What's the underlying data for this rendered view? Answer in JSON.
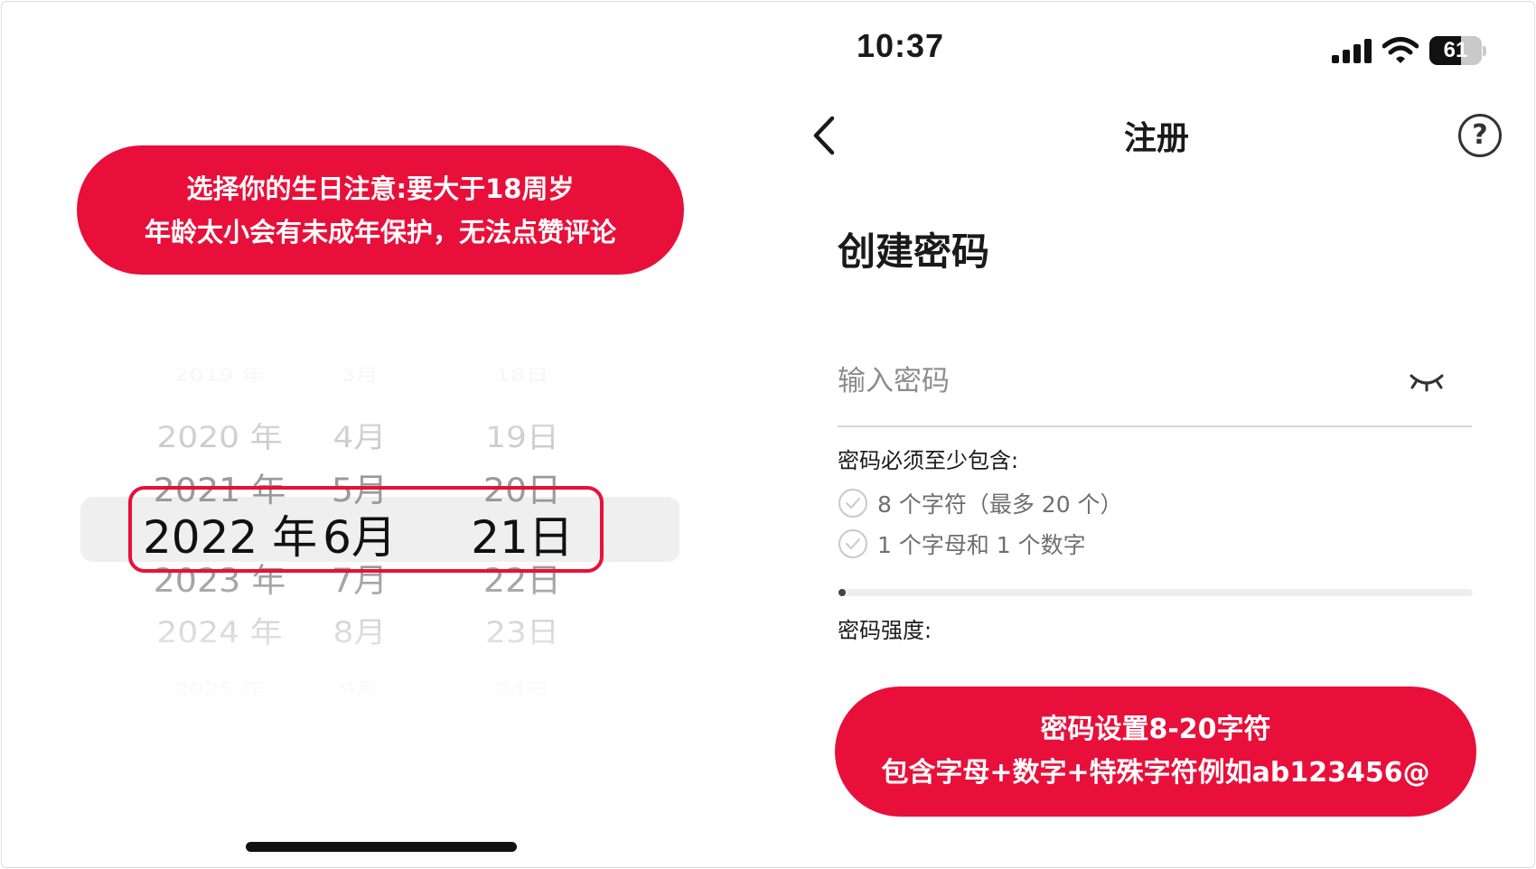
{
  "left": {
    "banner": {
      "line1": "选择你的生日注意:要大于18周岁",
      "line2": "年龄太小会有未成年保护，无法点赞评论"
    },
    "picker": {
      "rows": [
        {
          "year": "2019 年",
          "month": "3月",
          "day": "18日"
        },
        {
          "year": "2020 年",
          "month": "4月",
          "day": "19日"
        },
        {
          "year": "2021 年",
          "month": "5月",
          "day": "20日"
        },
        {
          "year": "2022 年",
          "month": "6月",
          "day": "21日"
        },
        {
          "year": "2023 年",
          "month": "7月",
          "day": "22日"
        },
        {
          "year": "2024 年",
          "month": "8月",
          "day": "23日"
        },
        {
          "year": "2025 年",
          "month": "9月",
          "day": "24日"
        }
      ],
      "selected_index": 3
    }
  },
  "right": {
    "status_bar": {
      "time": "10:37",
      "battery": "61",
      "battery_level": 0.61,
      "signal_icon": "cellular-signal-icon",
      "wifi_icon": "wifi-icon"
    },
    "nav": {
      "title": "注册",
      "back_icon": "chevron-left-icon",
      "help_label": "?"
    },
    "heading": "创建密码",
    "password": {
      "placeholder": "输入密码",
      "value": "",
      "toggle_icon": "eye-closed-icon"
    },
    "requirements": {
      "title": "密码必须至少包含:",
      "items": [
        "8 个字符（最多 20 个）",
        "1 个字母和 1 个数字"
      ]
    },
    "strength": {
      "label": "密码强度:",
      "level": 0.01
    },
    "banner": {
      "line1": "密码设置8-20字符",
      "line2": "包含字母+数字+特殊字符例如ab123456@"
    }
  },
  "colors": {
    "accent": "#e8103a",
    "text": "#1a1a1a",
    "muted": "#8c8c8c"
  }
}
